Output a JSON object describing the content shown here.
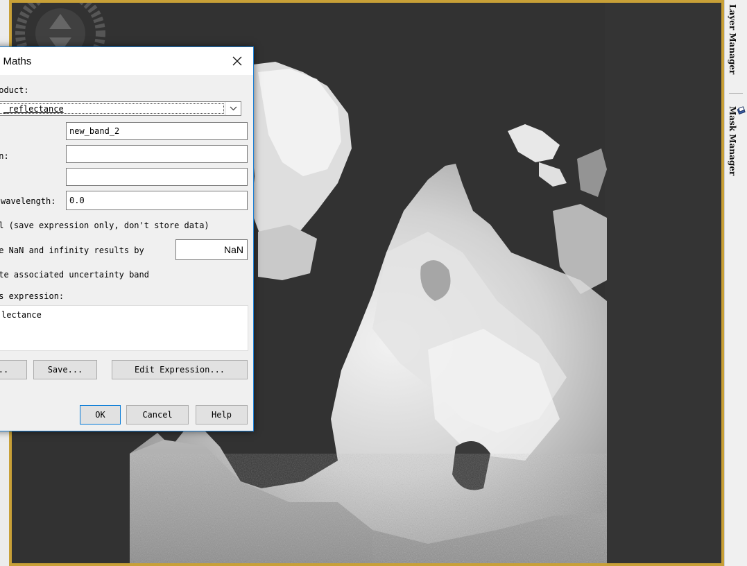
{
  "dialog": {
    "title": "l Maths",
    "target_product_label": "roduct:",
    "target_product_value": "_reflectance",
    "name_value": "new_band_2",
    "description_label": "on:",
    "description_value": "",
    "unit_value": "",
    "wavelength_label": "wavelength:",
    "wavelength_value": "0.0",
    "virtual_label": "al (save expression only, don't store data)",
    "replace_nan_label": "ce NaN and infinity results by",
    "replace_nan_value": "NaN",
    "uncertainty_label": "ate associated uncertainty band",
    "band_maths_expression_label": "as expression:",
    "expression_value": "lectance",
    "load_button": "..",
    "save_button": "Save...",
    "edit_expression_button": "Edit Expression...",
    "ok_button": "OK",
    "cancel_button": "Cancel",
    "help_button": "Help"
  },
  "right_panel": {
    "layer_manager_label": "Layer Manager",
    "mask_manager_label": "Mask Manager"
  },
  "icons": {
    "close": "close-icon",
    "dropdown": "chevron-down-icon",
    "mask": "mask-manager-icon",
    "navigation": "navigation-compass-icon"
  },
  "colors": {
    "view_frame": "#c8a037",
    "view_background": "#323232",
    "dialog_border": "#1b7fd4"
  }
}
